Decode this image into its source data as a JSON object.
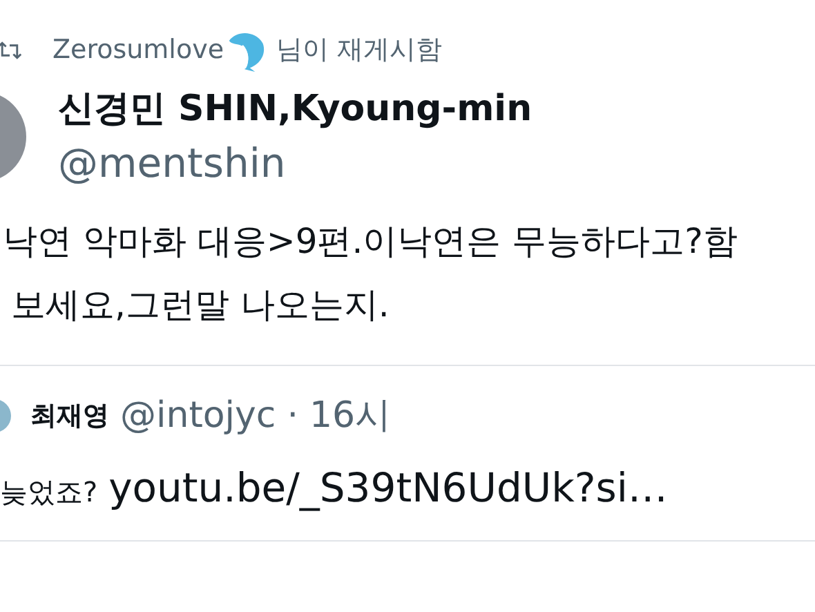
{
  "retweet": {
    "user": "Zerosumlove",
    "label": "님이 재게시함"
  },
  "author": {
    "name": "신경민 SHIN,Kyoung-min",
    "handle": "@mentshin"
  },
  "text_lines": [
    "낙연 악마화 대응>9편.이낙연은 무능하다고?함",
    "보세요,그런말 나오는지."
  ],
  "quote": {
    "name": "최재영",
    "handle": "@intojyc",
    "separator": "·",
    "time": "16시",
    "text": "늦었죠?",
    "link": "youtu.be/_S39tN6UdUk?si…"
  }
}
